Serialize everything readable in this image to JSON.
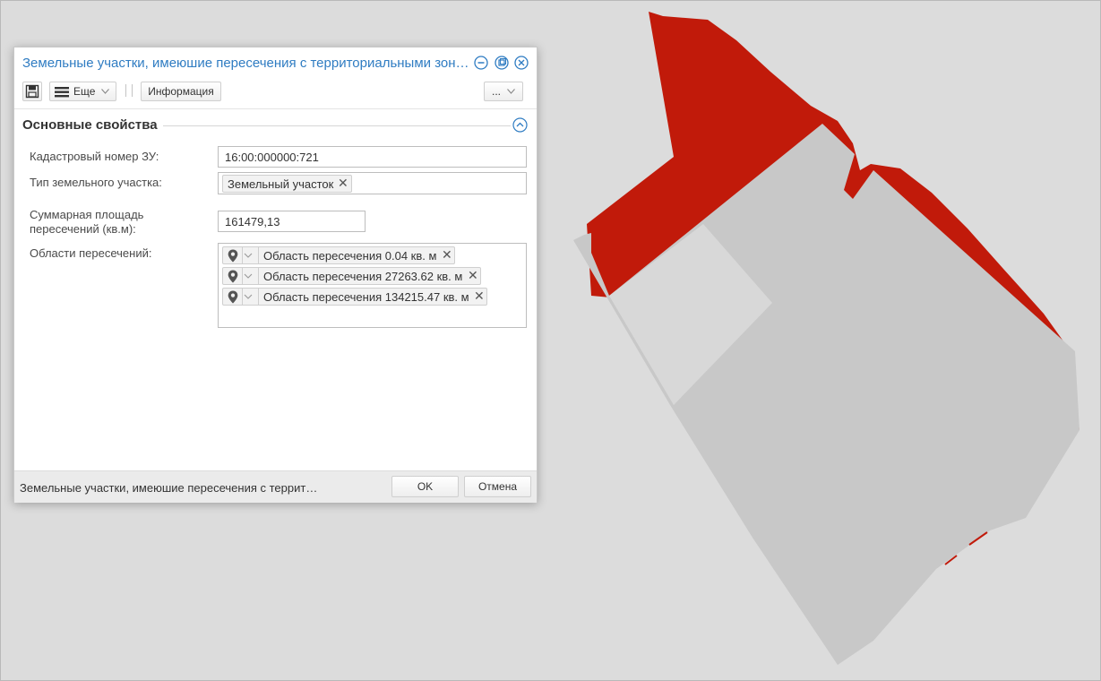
{
  "dialog": {
    "title": "Земельные участки, имеюшие пересечения с территориальными зон…",
    "toolbar": {
      "more_label": "Еще",
      "info_label": "Информация",
      "dots_label": "..."
    },
    "section": {
      "title": "Основные свойства"
    },
    "fields": {
      "cadastral": {
        "label": "Кадастровый номер ЗУ:",
        "value": "16:00:000000:721"
      },
      "type": {
        "label": "Тип земельного участка:",
        "tag": "Земельный участок"
      },
      "area": {
        "label_line1": "Суммарная площадь",
        "label_line2": "пересечений (кв.м):",
        "value": "161479,13"
      },
      "regions": {
        "label": "Области пересечений:",
        "items": [
          {
            "text": "Область пересечения 0.04 кв. м"
          },
          {
            "text": "Область пересечения 27263.62 кв. м"
          },
          {
            "text": "Область пересечения 134215.47 кв. м"
          }
        ]
      }
    },
    "footer": {
      "status_text": "Земельные участки, имеюшие пересечения с террит…",
      "ok_label": "OK",
      "cancel_label": "Отмена"
    }
  },
  "colors": {
    "accent": "#2f7cc2",
    "zone_red": "#c11a0a",
    "parcel_gray": "#c8c8c8",
    "background": "#dcdcdc"
  }
}
